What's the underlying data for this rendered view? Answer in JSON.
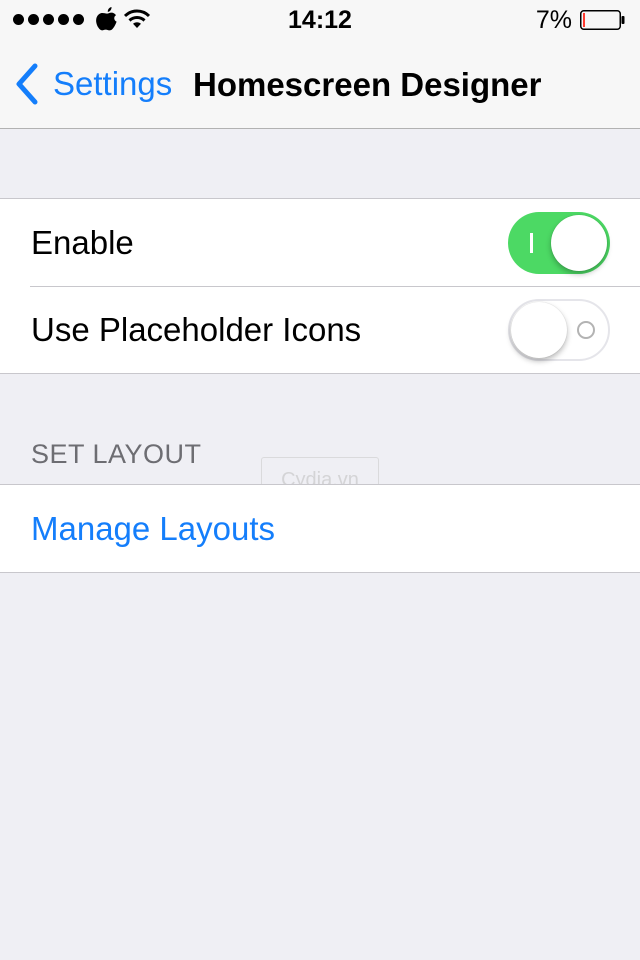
{
  "status_bar": {
    "signal_bars": 5,
    "carrier_icon": "apple-logo-icon",
    "wifi_icon": "wifi-icon",
    "time": "14:12",
    "battery_percent": "7%",
    "battery_level": 0.07,
    "battery_color": "#ff3b30"
  },
  "nav": {
    "back_label": "Settings",
    "title": "Homescreen Designer",
    "accent_color": "#147efb"
  },
  "settings": {
    "enable": {
      "label": "Enable",
      "value": true
    },
    "placeholder_icons": {
      "label": "Use Placeholder Icons",
      "value": false
    }
  },
  "set_layout": {
    "header": "SET LAYOUT",
    "manage_label": "Manage Layouts"
  },
  "watermark": {
    "text": "Cydia.vn"
  },
  "colors": {
    "switch_on": "#4cd964",
    "background": "#efeff4"
  }
}
